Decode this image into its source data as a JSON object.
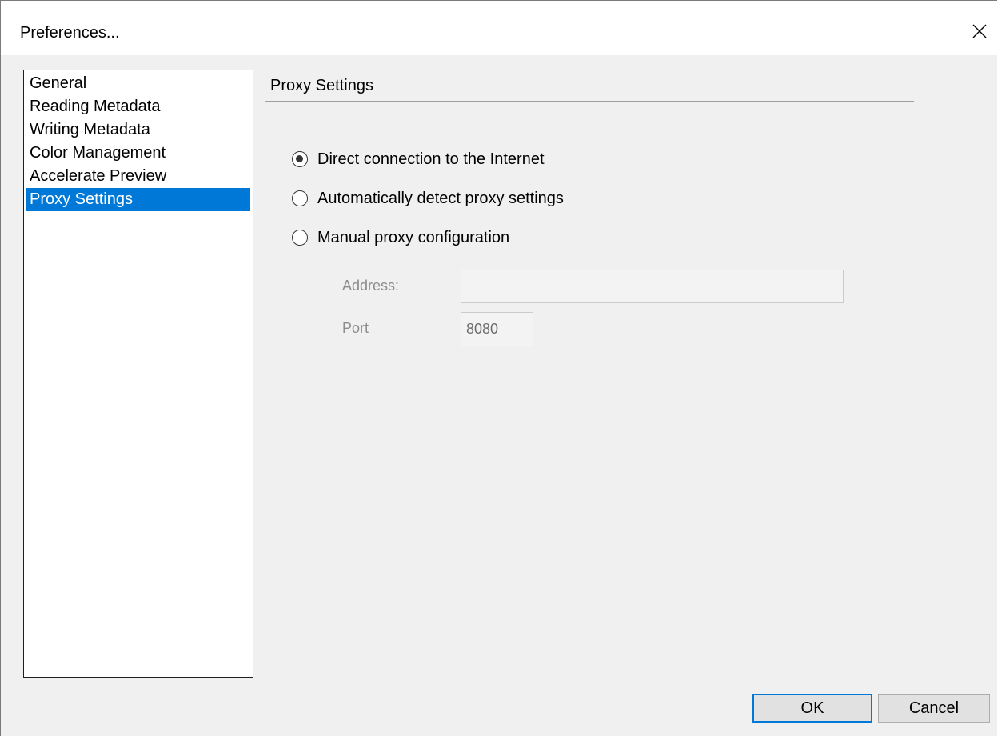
{
  "window": {
    "title": "Preferences...",
    "close_icon": "close-icon"
  },
  "nav": {
    "items": [
      {
        "label": "General",
        "selected": false
      },
      {
        "label": "Reading Metadata",
        "selected": false
      },
      {
        "label": "Writing Metadata",
        "selected": false
      },
      {
        "label": "Color Management",
        "selected": false
      },
      {
        "label": "Accelerate Preview",
        "selected": false
      },
      {
        "label": "Proxy Settings",
        "selected": true
      }
    ]
  },
  "section": {
    "title": "Proxy Settings"
  },
  "proxy": {
    "options": [
      {
        "label": "Direct connection to the Internet",
        "checked": true
      },
      {
        "label": "Automatically detect proxy settings",
        "checked": false
      },
      {
        "label": "Manual proxy configuration",
        "checked": false
      }
    ],
    "address_label": "Address:",
    "address_value": "",
    "port_label": "Port",
    "port_value": "8080"
  },
  "buttons": {
    "ok_label": "OK",
    "cancel_label": "Cancel"
  },
  "colors": {
    "selection": "#0078d7",
    "dialog_bg": "#f0f0f0",
    "disabled_text": "#8c8c8c"
  }
}
